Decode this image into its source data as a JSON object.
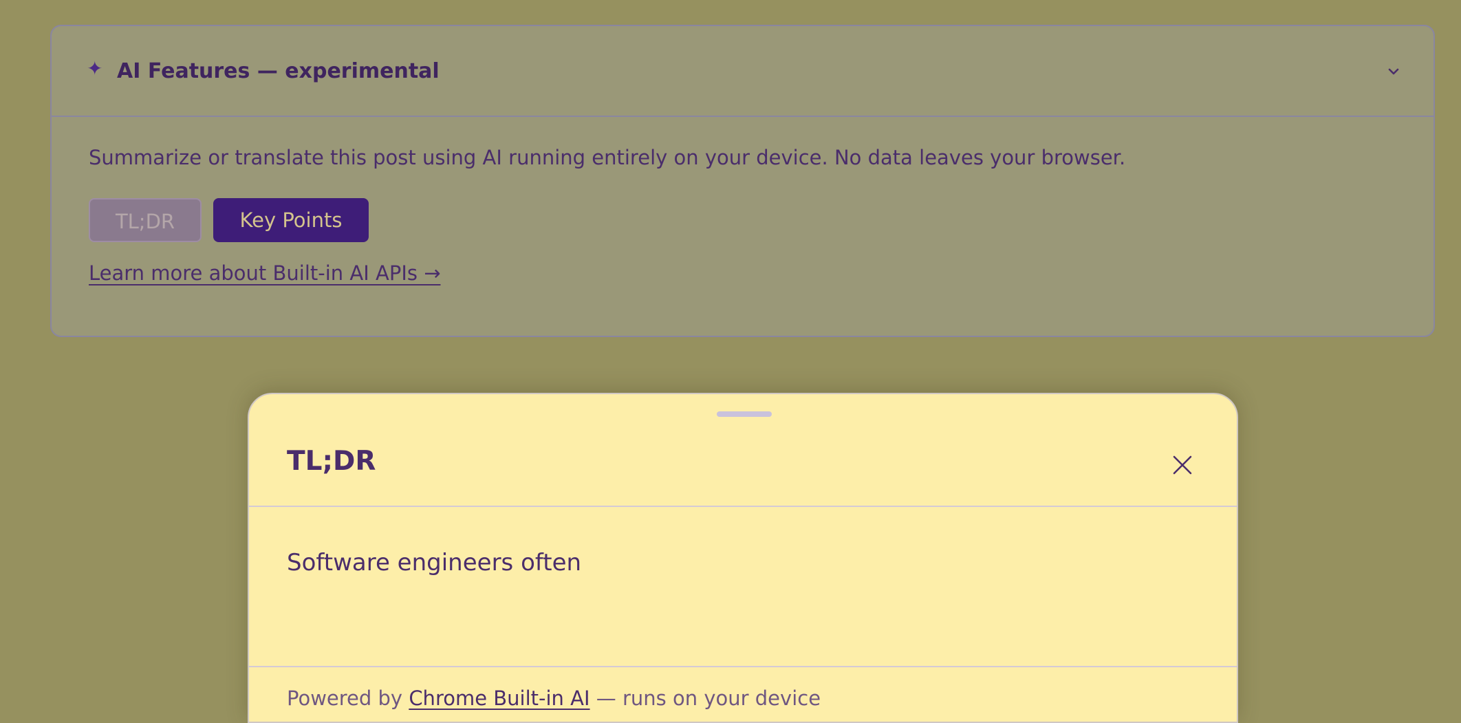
{
  "panel": {
    "title": "AI Features — experimental",
    "sparkle_icon": "sparkle-icon",
    "chevron_icon": "chevron-down-icon",
    "description": "Summarize or translate this post using AI running entirely on your device. No data leaves your browser.",
    "buttons": {
      "tldr": "TL;DR",
      "key_points": "Key Points"
    },
    "learn_more": "Learn more about Built-in AI APIs →"
  },
  "sheet": {
    "title": "TL;DR",
    "close_icon": "close-icon",
    "content": "Software engineers often",
    "footer": {
      "prefix": "Powered by",
      "link": "Chrome Built-in AI",
      "suffix": " — runs on your device"
    }
  },
  "colors": {
    "accent": "#3e1d78",
    "sheet_background": "#fdeea9",
    "page_background": "#96915f"
  }
}
